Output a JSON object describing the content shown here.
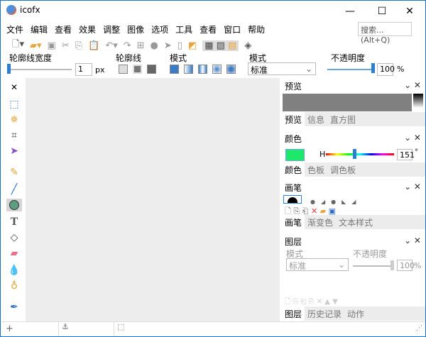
{
  "window": {
    "title": "icofx",
    "minimize": "—",
    "maximize": "☐",
    "close": "✕"
  },
  "menu": [
    "文件",
    "编辑",
    "查看",
    "效果",
    "调整",
    "图像",
    "选项",
    "工具",
    "查看",
    "窗口",
    "帮助"
  ],
  "search": {
    "placeholder": "搜索... (Alt+Q)"
  },
  "options": {
    "outline_width_label": "轮廓线宽度",
    "outline_width_value": "1",
    "unit": "px",
    "outline_label": "轮廓线",
    "mode_label": "模式",
    "blend_label": "模式",
    "blend_value": "标准",
    "opacity_label": "不透明度",
    "opacity_value": "100",
    "percent": "%"
  },
  "panels": {
    "preview": {
      "title": "预览",
      "tabs": [
        "预览",
        "信息",
        "直方图"
      ]
    },
    "color": {
      "title": "颜色",
      "h_label": "H",
      "h_value": "151",
      "degree": "°",
      "swatch": "#1ee86a",
      "tabs": [
        "颜色",
        "色板",
        "调色板"
      ]
    },
    "brush": {
      "title": "画笔",
      "tabs": [
        "画笔",
        "渐变色",
        "文本样式"
      ]
    },
    "layers": {
      "title": "图层",
      "mode_label": "模式",
      "mode_value": "标准",
      "opacity_label": "不透明度",
      "opacity_value": "100",
      "percent": "%",
      "tabs": [
        "图层",
        "历史记录",
        "动作"
      ]
    }
  },
  "status": {
    "add": "+",
    "anchor": "⚓"
  }
}
